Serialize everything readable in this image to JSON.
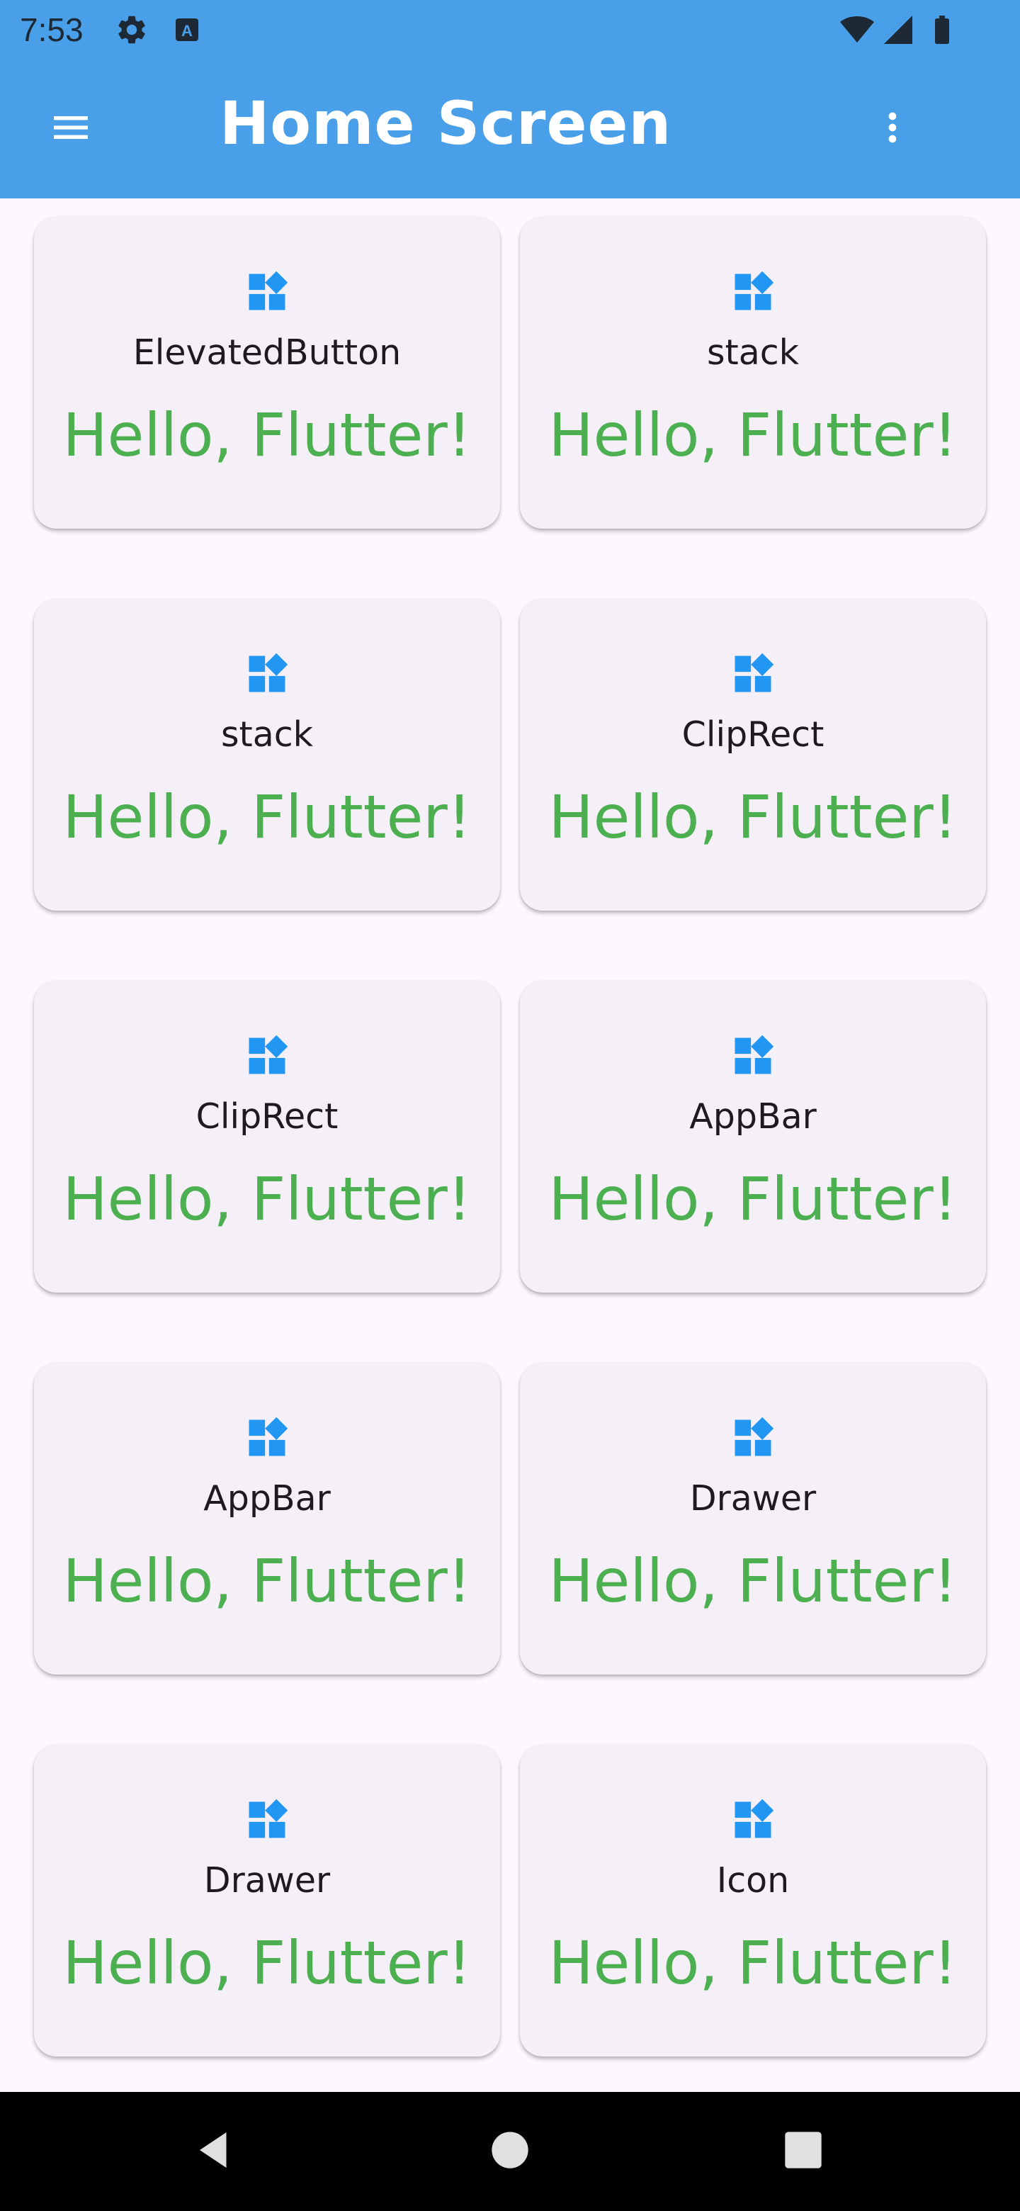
{
  "status_bar": {
    "time": "7:53",
    "icons": [
      "gear-icon",
      "keyboard-a-icon",
      "wifi-icon",
      "signal-icon",
      "battery-icon"
    ]
  },
  "app_bar": {
    "title": "Home Screen",
    "menu_icon": "hamburger-menu-icon",
    "more_icon": "more-vert-icon",
    "background": "#4a9fe9"
  },
  "cards": [
    {
      "label": "ElevatedButton",
      "text": "Hello, Flutter!",
      "icon": "widgets-icon"
    },
    {
      "label": "stack",
      "text": "Hello, Flutter!",
      "icon": "widgets-icon"
    },
    {
      "label": "stack",
      "text": "Hello, Flutter!",
      "icon": "widgets-icon"
    },
    {
      "label": "ClipRect",
      "text": "Hello, Flutter!",
      "icon": "widgets-icon"
    },
    {
      "label": "ClipRect",
      "text": "Hello, Flutter!",
      "icon": "widgets-icon"
    },
    {
      "label": "AppBar",
      "text": "Hello, Flutter!",
      "icon": "widgets-icon"
    },
    {
      "label": "AppBar",
      "text": "Hello, Flutter!",
      "icon": "widgets-icon"
    },
    {
      "label": "Drawer",
      "text": "Hello, Flutter!",
      "icon": "widgets-icon"
    },
    {
      "label": "Drawer",
      "text": "Hello, Flutter!",
      "icon": "widgets-icon"
    },
    {
      "label": "Icon",
      "text": "Hello, Flutter!",
      "icon": "widgets-icon"
    }
  ],
  "colors": {
    "accent": "#4a9fe9",
    "icon_blue": "#2196f3",
    "hello_green": "#4caf50",
    "card_bg": "#f5f0f7",
    "page_bg": "#fef7ff"
  },
  "nav_bar": {
    "icons": [
      "back-icon",
      "home-icon",
      "recents-icon"
    ]
  }
}
